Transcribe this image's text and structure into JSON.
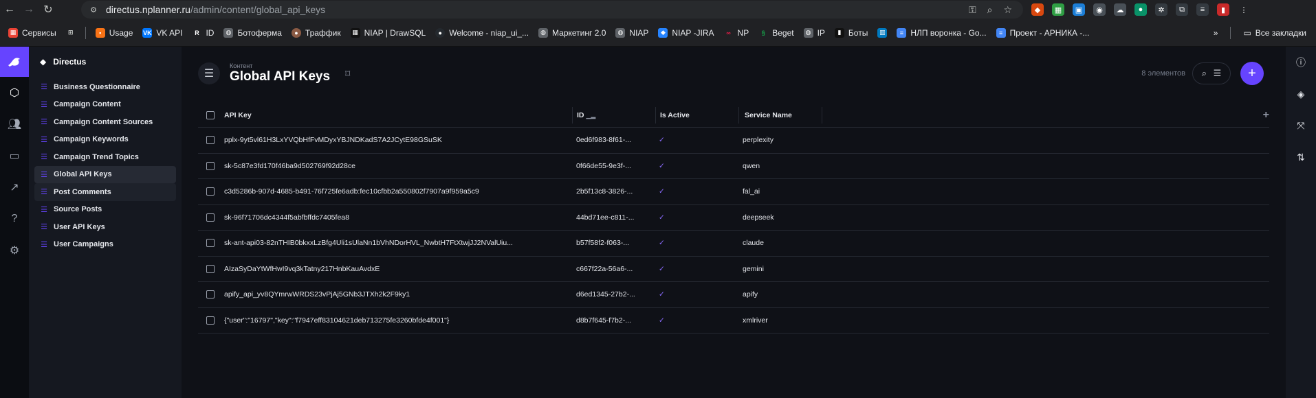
{
  "browser": {
    "url_host": "directus.nplanner.ru",
    "url_path": "/admin/content/global_api_keys",
    "bookmarks": [
      {
        "label": "Сервисы",
        "icon": "apps-icon",
        "color": "#ea4335"
      },
      {
        "label": "Usage",
        "icon": "usage-icon",
        "color": "#f97316"
      },
      {
        "label": "VK API",
        "icon": "vk-icon",
        "color": "#0077ff"
      },
      {
        "label": "ID",
        "icon": "r-icon",
        "color": "#3c4043"
      },
      {
        "label": "Ботоферма",
        "icon": "globe-icon",
        "color": "#5f6368"
      },
      {
        "label": "Траффик",
        "icon": "avatar-icon",
        "color": "#8a5a44"
      },
      {
        "label": "NIAP | DrawSQL",
        "icon": "drawsql-icon",
        "color": "#111111"
      },
      {
        "label": "Welcome - niap_ui_...",
        "icon": "github-icon",
        "color": "#24292e"
      },
      {
        "label": "Маркетинг 2.0",
        "icon": "globe-icon",
        "color": "#5f6368"
      },
      {
        "label": "NIAP",
        "icon": "globe-icon",
        "color": "#5f6368"
      },
      {
        "label": "NIAP -JIRA",
        "icon": "jira-icon",
        "color": "#2684ff"
      },
      {
        "label": "NP",
        "icon": "np-icon",
        "color": "#e11d48"
      },
      {
        "label": "Beget",
        "icon": "beget-icon",
        "color": "#16a34a"
      },
      {
        "label": "IP",
        "icon": "globe-icon",
        "color": "#5f6368"
      },
      {
        "label": "Боты",
        "icon": "bots-icon",
        "color": "#111111"
      },
      {
        "label": "",
        "icon": "trello-icon",
        "color": "#0079bf"
      },
      {
        "label": "НЛП воронка - Go...",
        "icon": "docs-icon",
        "color": "#4285f4"
      },
      {
        "label": "Проект - АРНИКА -...",
        "icon": "docs-icon",
        "color": "#4285f4"
      }
    ],
    "all_bookmarks": "Все закладки"
  },
  "nav": {
    "project": "Directus",
    "collections": [
      "Business Questionnaire",
      "Campaign Content",
      "Campaign Content Sources",
      "Campaign Keywords",
      "Campaign Trend Topics",
      "Global API Keys",
      "Post Comments",
      "Source Posts",
      "User API Keys",
      "User Campaigns"
    ]
  },
  "header": {
    "breadcrumb": "Контент",
    "title": "Global API Keys",
    "count": "8 элементов"
  },
  "table": {
    "columns": [
      "API Key",
      "ID",
      "Is Active",
      "Service Name"
    ],
    "rows": [
      {
        "api_key": "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",
        "id": "0ed6f983-8f61-...",
        "active": "✓",
        "service": "perplexity"
      },
      {
        "api_key": "sk-5c87e3fd170f46ba9d502769f92d28ce",
        "id": "0f66de55-9e3f-...",
        "active": "✓",
        "service": "qwen"
      },
      {
        "api_key": "c3d5286b-907d-4685-b491-76f725fe6adb:fec10cfbb2a550802f7907a9f959a5c9",
        "id": "2b5f13c8-3826-...",
        "active": "✓",
        "service": "fal_ai"
      },
      {
        "api_key": "sk-96f71706dc4344f5abfbffdc7405fea8",
        "id": "44bd71ee-c811-...",
        "active": "✓",
        "service": "deepseek"
      },
      {
        "api_key": "sk-ant-api03-82nTHIB0bkxxLzBfg4Uli1sUlaNn1bVhNDorHVL_NwbtH7FtXtwjJJ2NValUiu...",
        "id": "b57f58f2-f063-...",
        "active": "✓",
        "service": "claude"
      },
      {
        "api_key": "AIzaSyDaYtWfHwI9vq3kTatny217HnbKauAvdxE",
        "id": "c667f22a-56a6-...",
        "active": "✓",
        "service": "gemini"
      },
      {
        "api_key": "apify_api_yv8QYmrwWRDS23vPjAj5GNb3JTXh2k2F9ky1",
        "id": "d6ed1345-27b2-...",
        "active": "✓",
        "service": "apify"
      },
      {
        "api_key": "{\"user\":\"16797\",\"key\":\"f7947eff83104621deb713275fe3260bfde4f001\"}",
        "id": "d8b7f645-f7b2-...",
        "active": "✓",
        "service": "xmlriver"
      }
    ]
  },
  "colors": {
    "accent": "#6644ff",
    "background": "#0f1117",
    "nav": "#151820"
  }
}
